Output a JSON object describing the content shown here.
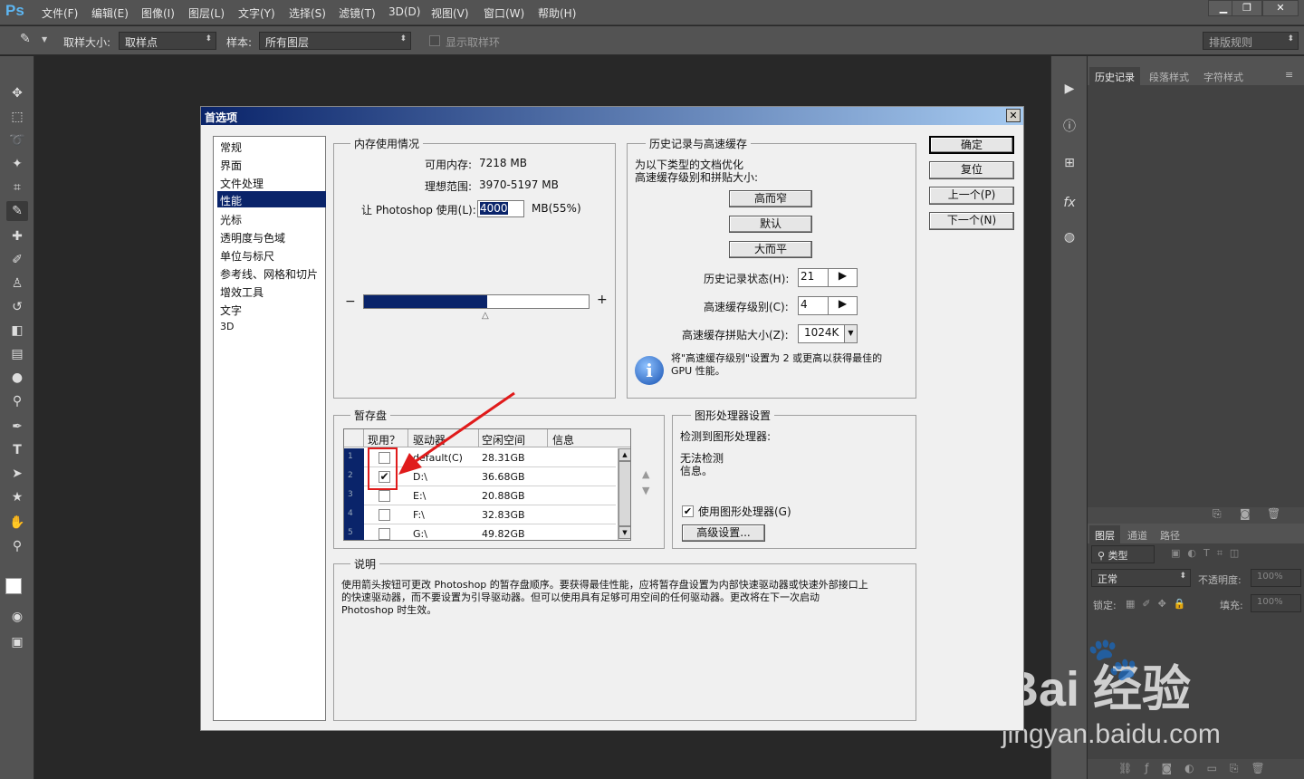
{
  "app": {
    "logo": "Ps",
    "menus": [
      "文件(F)",
      "编辑(E)",
      "图像(I)",
      "图层(L)",
      "文字(Y)",
      "选择(S)",
      "滤镜(T)",
      "3D(D)",
      "视图(V)",
      "窗口(W)",
      "帮助(H)"
    ],
    "window_controls": [
      "minimize-icon",
      "restore-icon",
      "close-icon"
    ]
  },
  "options": {
    "sample_size_label": "取样大小:",
    "sample_size_value": "取样点",
    "sample_label": "样本:",
    "sample_value": "所有图层",
    "show_ring_label": "显示取样环",
    "workspace": "排版规则"
  },
  "panels": {
    "top_tabs": [
      "历史记录",
      "段落样式",
      "字符样式"
    ],
    "layer_tabs": [
      "图层",
      "通道",
      "路径"
    ],
    "filter_type": "类型",
    "blend_mode": "正常",
    "opacity_label": "不透明度:",
    "opacity_value": "100%",
    "lock_label": "锁定:",
    "fill_label": "填充:",
    "fill_value": "100%"
  },
  "dialog": {
    "title": "首选项",
    "categories": [
      "常规",
      "界面",
      "文件处理",
      "性能",
      "光标",
      "透明度与色域",
      "单位与标尺",
      "参考线、网格和切片",
      "增效工具",
      "文字",
      "3D"
    ],
    "selected_category": 3,
    "buttons": {
      "ok": "确定",
      "reset": "复位",
      "prev": "上一个(P)",
      "next": "下一个(N)"
    },
    "memory": {
      "title": "内存使用情况",
      "available_label": "可用内存:",
      "available_value": "7218 MB",
      "ideal_label": "理想范围:",
      "ideal_value": "3970-5197 MB",
      "use_label": "让 Photoshop 使用(L):",
      "use_value": "4000",
      "use_unit": "MB(55%)",
      "minus": "−",
      "plus": "+",
      "slider_fraction": 0.55
    },
    "history": {
      "title": "历史记录与高速缓存",
      "desc1": "为以下类型的文档优化",
      "desc2": "高速缓存级别和拼贴大小:",
      "btn_tall": "高而窄",
      "btn_default": "默认",
      "btn_wide": "大而平",
      "states_label": "历史记录状态(H):",
      "states_value": "21",
      "levels_label": "高速缓存级别(C):",
      "levels_value": "4",
      "tile_label": "高速缓存拼贴大小(Z):",
      "tile_value": "1024K",
      "info_line1": "将\"高速缓存级别\"设置为 2 或更高以获得最佳的",
      "info_line2": "GPU 性能。"
    },
    "scratch": {
      "title": "暂存盘",
      "headers": [
        "现用？",
        "驱动器",
        "空闲空间",
        "信息"
      ],
      "rows": [
        {
          "num": "1",
          "active": false,
          "drive": "default(C)",
          "free": "28.31GB"
        },
        {
          "num": "2",
          "active": true,
          "drive": "D:\\",
          "free": "36.68GB"
        },
        {
          "num": "3",
          "active": false,
          "drive": "E:\\",
          "free": "20.88GB"
        },
        {
          "num": "4",
          "active": false,
          "drive": "F:\\",
          "free": "32.83GB"
        },
        {
          "num": "5",
          "active": false,
          "drive": "G:\\",
          "free": "49.82GB"
        }
      ]
    },
    "gpu": {
      "title": "图形处理器设置",
      "detected_label": "检测到图形处理器:",
      "detected_line1": "无法检测",
      "detected_line2": "信息。",
      "use_gpu_label": "使用图形处理器(G)",
      "use_gpu_checked": true,
      "advanced_button": "高级设置..."
    },
    "description": {
      "title": "说明",
      "line1": "使用箭头按钮可更改 Photoshop 的暂存盘顺序。要获得最佳性能，应将暂存盘设置为内部快速驱动器或快速外部接口上",
      "line2": "的快速驱动器，而不要设置为引导驱动器。但可以使用具有足够可用空间的任何驱动器。更改将在下一次启动",
      "line3": "Photoshop 时生效。"
    }
  },
  "watermark": {
    "brand": "Bai  经验",
    "url": "jingyan.baidu.com"
  },
  "colors": {
    "accent": "#0a246a",
    "annotation": "#e01b1b",
    "ps_blue": "#5db6f2"
  }
}
